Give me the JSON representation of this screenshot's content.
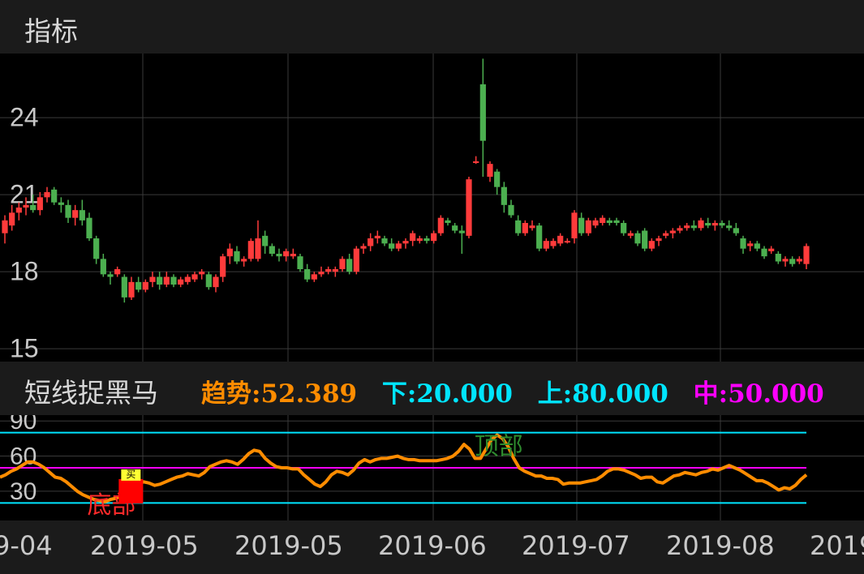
{
  "header": {
    "title": "指标"
  },
  "main_chart": {
    "y_ticks": [
      "24",
      "21",
      "18",
      "15"
    ],
    "colors": {
      "up": "#ff3b3b",
      "down": "#4caf50",
      "grid": "#3a3a3a"
    }
  },
  "indicator": {
    "name": "短线捉黑马",
    "trend": {
      "label": "趋势",
      "value": ":52.389",
      "color": "#ff8c00"
    },
    "lower": {
      "label": "下",
      "value": ":20.000",
      "color": "#00e5ff"
    },
    "upper": {
      "label": "上",
      "value": ":80.000",
      "color": "#00e5ff"
    },
    "middle": {
      "label": "中",
      "value": ":50.000",
      "color": "#ff00ff"
    },
    "y_ticks": [
      "90",
      "60",
      "30"
    ],
    "top_marker": "顶部",
    "bottom_marker": "底部",
    "bottom_badge": "买"
  },
  "chart_data": {
    "type": "candlestick",
    "x_tick_labels": [
      "9-04",
      "2019-05",
      "2019-05",
      "2019-06",
      "2019-07",
      "2019-08",
      "2019"
    ],
    "y_range": [
      14.5,
      26.5
    ],
    "candles": [
      [
        19.5,
        20.2,
        19.1,
        20.0
      ],
      [
        19.8,
        20.6,
        19.6,
        20.3
      ],
      [
        20.3,
        20.7,
        20.0,
        20.5
      ],
      [
        20.5,
        20.9,
        20.2,
        20.6
      ],
      [
        20.6,
        21.0,
        20.3,
        20.4
      ],
      [
        20.4,
        21.1,
        20.2,
        20.9
      ],
      [
        20.9,
        21.3,
        20.7,
        21.1
      ],
      [
        21.2,
        21.3,
        20.6,
        20.7
      ],
      [
        20.7,
        20.9,
        20.3,
        20.6
      ],
      [
        20.6,
        20.8,
        19.9,
        20.1
      ],
      [
        20.1,
        20.6,
        19.8,
        20.4
      ],
      [
        20.4,
        20.8,
        19.8,
        20.0
      ],
      [
        20.1,
        20.3,
        19.2,
        19.3
      ],
      [
        19.3,
        19.4,
        18.3,
        18.5
      ],
      [
        18.5,
        18.7,
        17.8,
        17.9
      ],
      [
        17.9,
        18.0,
        17.5,
        17.8
      ],
      [
        17.9,
        18.2,
        17.8,
        18.1
      ],
      [
        17.8,
        17.9,
        16.8,
        17.0
      ],
      [
        17.0,
        17.8,
        16.9,
        17.6
      ],
      [
        17.6,
        17.8,
        17.2,
        17.3
      ],
      [
        17.3,
        17.7,
        17.2,
        17.6
      ],
      [
        17.6,
        18.0,
        17.4,
        17.8
      ],
      [
        17.8,
        18.0,
        17.3,
        17.5
      ],
      [
        17.5,
        18.0,
        17.4,
        17.8
      ],
      [
        17.8,
        17.9,
        17.4,
        17.5
      ],
      [
        17.5,
        17.8,
        17.4,
        17.7
      ],
      [
        17.6,
        17.9,
        17.5,
        17.8
      ],
      [
        17.7,
        18.0,
        17.6,
        17.9
      ],
      [
        17.9,
        18.1,
        17.7,
        18.0
      ],
      [
        17.9,
        18.0,
        17.3,
        17.4
      ],
      [
        17.4,
        17.9,
        17.2,
        17.8
      ],
      [
        17.8,
        18.7,
        17.6,
        18.6
      ],
      [
        18.6,
        19.1,
        18.3,
        18.9
      ],
      [
        18.8,
        19.0,
        18.3,
        18.4
      ],
      [
        18.4,
        18.6,
        18.2,
        18.5
      ],
      [
        18.5,
        19.3,
        18.4,
        19.2
      ],
      [
        18.5,
        20.0,
        18.4,
        19.3
      ],
      [
        19.4,
        19.6,
        18.7,
        19.0
      ],
      [
        19.0,
        19.1,
        18.6,
        18.7
      ],
      [
        18.7,
        18.9,
        18.4,
        18.6
      ],
      [
        18.6,
        18.9,
        18.4,
        18.8
      ],
      [
        18.6,
        18.9,
        18.5,
        18.7
      ],
      [
        18.6,
        18.7,
        18.0,
        18.1
      ],
      [
        18.1,
        18.3,
        17.6,
        17.7
      ],
      [
        17.7,
        18.0,
        17.6,
        17.9
      ],
      [
        17.9,
        18.2,
        17.8,
        18.0
      ],
      [
        18.0,
        18.2,
        17.9,
        18.1
      ],
      [
        18.0,
        18.2,
        17.8,
        18.1
      ],
      [
        18.1,
        18.6,
        18.0,
        18.5
      ],
      [
        18.5,
        18.7,
        17.9,
        18.0
      ],
      [
        18.0,
        19.0,
        17.9,
        18.9
      ],
      [
        18.9,
        19.1,
        18.7,
        19.0
      ],
      [
        19.0,
        19.5,
        18.8,
        19.3
      ],
      [
        19.3,
        19.6,
        19.1,
        19.4
      ],
      [
        19.3,
        19.4,
        19.0,
        19.1
      ],
      [
        19.1,
        19.3,
        18.8,
        18.9
      ],
      [
        18.9,
        19.2,
        18.8,
        19.1
      ],
      [
        19.1,
        19.3,
        18.9,
        19.2
      ],
      [
        19.2,
        19.6,
        19.0,
        19.5
      ],
      [
        19.2,
        19.4,
        19.1,
        19.3
      ],
      [
        19.3,
        19.4,
        19.1,
        19.2
      ],
      [
        19.2,
        19.6,
        19.1,
        19.5
      ],
      [
        19.5,
        20.2,
        19.4,
        20.1
      ],
      [
        20.0,
        20.1,
        19.8,
        19.9
      ],
      [
        19.8,
        19.9,
        19.5,
        19.6
      ],
      [
        19.6,
        19.8,
        18.7,
        19.5
      ],
      [
        19.4,
        21.7,
        19.3,
        21.6
      ],
      [
        22.3,
        22.5,
        22.2,
        22.3
      ],
      [
        25.3,
        26.3,
        21.7,
        23.1
      ],
      [
        21.7,
        22.3,
        21.5,
        22.2
      ],
      [
        21.9,
        22.0,
        21.0,
        21.3
      ],
      [
        21.3,
        21.5,
        20.3,
        20.6
      ],
      [
        20.6,
        20.8,
        20.1,
        20.2
      ],
      [
        20.0,
        20.2,
        19.4,
        19.5
      ],
      [
        19.5,
        20.0,
        19.4,
        19.9
      ],
      [
        19.7,
        20.0,
        19.6,
        19.8
      ],
      [
        19.8,
        19.9,
        18.8,
        18.9
      ],
      [
        18.9,
        19.3,
        18.8,
        19.2
      ],
      [
        19.0,
        19.3,
        18.9,
        19.2
      ],
      [
        19.1,
        19.5,
        19.0,
        19.4
      ],
      [
        19.2,
        19.3,
        19.1,
        19.2
      ],
      [
        19.3,
        20.4,
        19.1,
        20.3
      ],
      [
        20.1,
        20.3,
        19.4,
        19.5
      ],
      [
        19.5,
        20.1,
        19.4,
        20.0
      ],
      [
        19.8,
        20.1,
        19.7,
        20.0
      ],
      [
        19.9,
        20.2,
        19.8,
        20.1
      ],
      [
        20.0,
        20.1,
        19.8,
        19.9
      ],
      [
        20.0,
        20.1,
        19.8,
        19.9
      ],
      [
        19.9,
        20.0,
        19.4,
        19.5
      ],
      [
        19.4,
        19.6,
        19.3,
        19.5
      ],
      [
        19.5,
        19.6,
        19.0,
        19.1
      ],
      [
        19.6,
        19.7,
        18.8,
        18.9
      ],
      [
        18.9,
        19.3,
        18.8,
        19.2
      ],
      [
        19.2,
        19.4,
        19.0,
        19.3
      ],
      [
        19.4,
        19.6,
        19.3,
        19.5
      ],
      [
        19.5,
        19.7,
        19.3,
        19.6
      ],
      [
        19.6,
        19.8,
        19.5,
        19.7
      ],
      [
        19.7,
        19.9,
        19.6,
        19.8
      ],
      [
        19.8,
        20.0,
        19.6,
        19.7
      ],
      [
        19.7,
        20.1,
        19.6,
        20.0
      ],
      [
        19.9,
        20.1,
        19.7,
        19.8
      ],
      [
        19.8,
        20.0,
        19.6,
        19.9
      ],
      [
        19.9,
        20.0,
        19.7,
        19.8
      ],
      [
        19.8,
        20.0,
        19.6,
        19.7
      ],
      [
        19.7,
        19.9,
        19.4,
        19.5
      ],
      [
        19.3,
        19.4,
        18.7,
        18.9
      ],
      [
        19.0,
        19.2,
        18.8,
        19.1
      ],
      [
        19.1,
        19.2,
        18.8,
        18.9
      ],
      [
        18.9,
        19.0,
        18.5,
        18.6
      ],
      [
        18.8,
        19.0,
        18.7,
        18.9
      ],
      [
        18.7,
        18.8,
        18.3,
        18.4
      ],
      [
        18.4,
        18.6,
        18.2,
        18.5
      ],
      [
        18.5,
        18.6,
        18.2,
        18.3
      ],
      [
        18.4,
        18.6,
        18.3,
        18.5
      ],
      [
        18.3,
        19.1,
        18.1,
        19.0
      ]
    ],
    "indicator_y_range": [
      5,
      95
    ],
    "indicator_levels": {
      "lower": 20,
      "middle": 50,
      "upper": 80
    },
    "trend_line": [
      42,
      44,
      47,
      49,
      52,
      55,
      55,
      53,
      50,
      46,
      42,
      41,
      38,
      34,
      30,
      27,
      25,
      23,
      22,
      21,
      23,
      24,
      26,
      28,
      31,
      36,
      38,
      37,
      35,
      36,
      38,
      40,
      42,
      43,
      45,
      44,
      43,
      46,
      51,
      53,
      55,
      56,
      55,
      53,
      57,
      62,
      65,
      64,
      58,
      54,
      51,
      50,
      50,
      49,
      49,
      44,
      40,
      36,
      34,
      38,
      44,
      47,
      46,
      44,
      48,
      54,
      57,
      55,
      57,
      58,
      58,
      59,
      60,
      58,
      57,
      57,
      56,
      56,
      56,
      56,
      57,
      58,
      60,
      64,
      70,
      66,
      58,
      58,
      66,
      74,
      78,
      75,
      68,
      58,
      50,
      47,
      45,
      43,
      43,
      41,
      41,
      40,
      36,
      37,
      37,
      37,
      38,
      39,
      40,
      43,
      47,
      49,
      49,
      48,
      46,
      44,
      41,
      42,
      42,
      38,
      37,
      40,
      43,
      44,
      46,
      45,
      44,
      46,
      47,
      49,
      48,
      50,
      52,
      50,
      48,
      45,
      42,
      39,
      39,
      37,
      34,
      31,
      33,
      32,
      35,
      40,
      44
    ]
  }
}
